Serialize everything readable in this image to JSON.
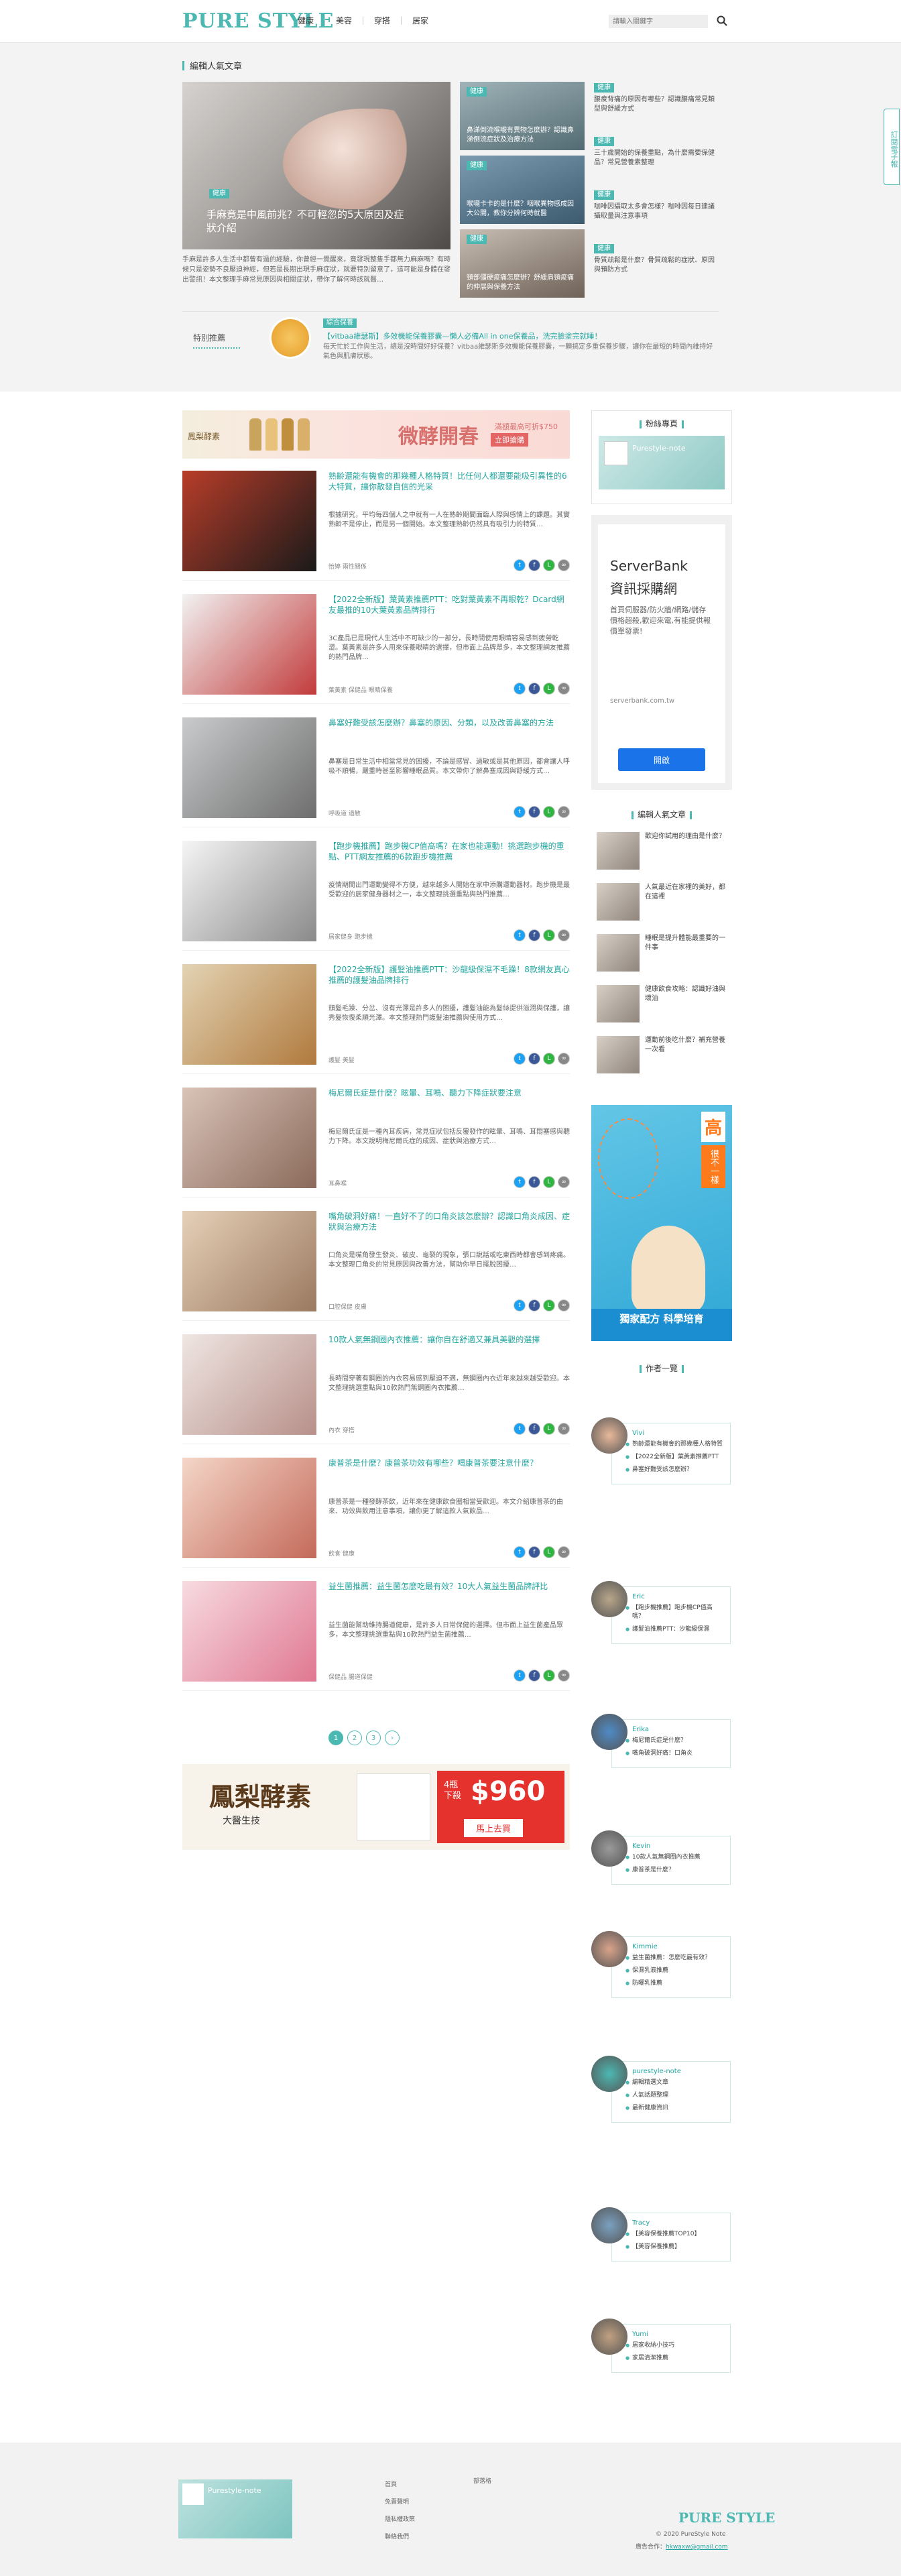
{
  "header": {
    "logo": "PURE STYLE",
    "nav": [
      "健康",
      "美容",
      "穿搭",
      "居家"
    ],
    "search_placeholder": "請輸入關鍵字"
  },
  "side_tab": "訂閱電子報",
  "featured": {
    "section_title": "編輯人氣文章",
    "big": {
      "tag": "健康",
      "title": "手麻竟是中風前兆？不可輕忽的5大原因及症狀介紹",
      "desc": "手麻是許多人生活中都曾有過的經驗，你曾經一覺醒來，竟發現整隻手都無力麻麻嗎？有時候只是姿勢不良壓迫神經，但若是長期出現手麻症狀，就要特別留意了，這可能是身體在發出警訊！本文整理手麻常見原因與相關症狀，帶你了解何時該就醫…"
    },
    "mid": [
      {
        "tag": "健康",
        "title": "鼻涕倒流喉嚨有異物怎麼辦？認識鼻涕倒流症狀及治療方法",
        "c1": "#9fb3b8",
        "c2": "#526b72"
      },
      {
        "tag": "健康",
        "title": "喉嚨卡卡的是什麼？咽喉異物感成因大公開，教你分辨何時就醫",
        "c1": "#7b9bb1",
        "c2": "#3d5a6e"
      },
      {
        "tag": "健康",
        "title": "頸部僵硬痠痛怎麼辦？舒緩肩頸痠痛的伸展與保養方法",
        "c1": "#c7bdb2",
        "c2": "#6f6258"
      }
    ],
    "right": [
      {
        "tag": "健康",
        "title": "腰痠背痛的原因有哪些？認識腰痛常見類型與舒緩方式"
      },
      {
        "tag": "健康",
        "title": "三十歲開始的保養重點，為什麼需要保健品？常見營養素整理"
      },
      {
        "tag": "健康",
        "title": "咖啡因攝取太多會怎樣？咖啡因每日建議攝取量與注意事項"
      },
      {
        "tag": "健康",
        "title": "骨質疏鬆是什麼？骨質疏鬆的症狀、原因與預防方式"
      }
    ],
    "hot": {
      "label": "特別推薦",
      "tag": "綜合保養",
      "title": "【vitbaa維瑟斯】多效機能保養膠囊—懶人必備All in one保養品，洗完臉塗完就睡！",
      "desc": "每天忙於工作與生活，總是沒時間好好保養？vitbaa維瑟斯多效機能保養膠囊，一顆搞定多重保養步驟，讓你在最短的時間內維持好氣色與肌膚狀態。"
    }
  },
  "banner1": {
    "left": "鳳梨酵素",
    "main": "微酵開春",
    "sub": "滿額最高可折$750",
    "cta": "立即搶購"
  },
  "posts": [
    {
      "title": "熟齡還能有機會的那幾種人格特質！比任何人都還要能吸引異性的6大特質，讓你散發自信的光采",
      "desc": "根據研究，平均每四個人之中就有一人在熟齡期間面臨人際與感情上的課題。其實熟齡不是停止，而是另一個開始。本文整理熟齡仍然具有吸引力的特質…",
      "meta": "怡婷  兩性關係",
      "thumb": "#b83d29",
      "thumb2": "#1a1a1a"
    },
    {
      "title": "【2022全新版】葉黃素推薦PTT：吃對葉黃素不再眼乾？Dcard網友最推的10大葉黃素品牌排行",
      "desc": "3C產品已是現代人生活中不可缺少的一部分，長時間使用眼睛容易感到疲勞乾澀。葉黃素是許多人用來保養眼睛的選擇，但市面上品牌眾多，本文整理網友推薦的熱門品牌…",
      "meta": "葉黃素  保健品  眼睛保養",
      "thumb": "#f2f2f2",
      "thumb2": "#c23b3b"
    },
    {
      "title": "鼻塞好難受該怎麼辦？鼻塞的原因、分類，以及改善鼻塞的方法",
      "desc": "鼻塞是日常生活中相當常見的困擾，不論是感冒、過敏或是其他原因，都會讓人呼吸不順暢，嚴重時甚至影響睡眠品質。本文帶你了解鼻塞成因與舒緩方式…",
      "meta": "呼吸道  過敏",
      "thumb": "#c9cbcc",
      "thumb2": "#6e6e6e"
    },
    {
      "title": "【跑步機推薦】跑步機CP值高嗎？在家也能運動！挑選跑步機的重點、PTT網友推薦的6款跑步機推薦",
      "desc": "疫情期間出門運動變得不方便，越來越多人開始在家中添購運動器材。跑步機是最受歡迎的居家健身器材之一，本文整理挑選重點與熱門推薦…",
      "meta": "居家健身  跑步機",
      "thumb": "#f5f5f5",
      "thumb2": "#8a8a8a"
    },
    {
      "title": "【2022全新版】護髮油推薦PTT：沙龍級保濕不毛躁！8款網友真心推薦的護髮油品牌排行",
      "desc": "頭髮毛躁、分岔、沒有光澤是許多人的困擾，護髮油能為髮絲提供滋潤與保護，讓秀髮恢復柔順光澤。本文整理熱門護髮油推薦與使用方式…",
      "meta": "護髮  美髮",
      "thumb": "#e3d3b3",
      "thumb2": "#b07a3e"
    },
    {
      "title": "梅尼爾氏症是什麼？眩暈、耳鳴、聽力下降症狀要注意",
      "desc": "梅尼爾氏症是一種內耳疾病，常見症狀包括反覆發作的眩暈、耳鳴、耳悶塞感與聽力下降。本文說明梅尼爾氏症的成因、症狀與治療方式…",
      "meta": "耳鼻喉",
      "thumb": "#d9c3b8",
      "thumb2": "#8a6a5a"
    },
    {
      "title": "嘴角破洞好痛！一直好不了的口角炎該怎麼辦？認識口角炎成因、症狀與治療方法",
      "desc": "口角炎是嘴角發生發炎、破皮、龜裂的現象，張口說話或吃東西時都會感到疼痛。本文整理口角炎的常見原因與改善方法，幫助你早日擺脫困擾…",
      "meta": "口腔保健  皮膚",
      "thumb": "#e6d0b8",
      "thumb2": "#9a7a60"
    },
    {
      "title": "10款人氣無鋼圈內衣推薦：讓你自在舒適又兼具美觀的選擇",
      "desc": "長時間穿著有鋼圈的內衣容易感到壓迫不適，無鋼圈內衣近年來越來越受歡迎。本文整理挑選重點與10款熱門無鋼圈內衣推薦…",
      "meta": "內衣  穿搭",
      "thumb": "#efe6e2",
      "thumb2": "#b8908a"
    },
    {
      "title": "康普茶是什麼？康普茶功效有哪些？喝康普茶要注意什麼？",
      "desc": "康普茶是一種發酵茶飲，近年來在健康飲食圈相當受歡迎。本文介紹康普茶的由來、功效與飲用注意事項，讓你更了解這款人氣飲品…",
      "meta": "飲食  健康",
      "thumb": "#f4d6c8",
      "thumb2": "#c46a5a"
    },
    {
      "title": "益生菌推薦：益生菌怎麼吃最有效？10大人氣益生菌品牌評比",
      "desc": "益生菌能幫助維持腸道健康，是許多人日常保健的選擇。但市面上益生菌產品眾多，本文整理挑選重點與10款熱門益生菌推薦…",
      "meta": "保健品  腸道保健",
      "thumb": "#f7dbe1",
      "thumb2": "#e07891"
    }
  ],
  "pager": [
    "1",
    "2",
    "3",
    "›"
  ],
  "banner2": {
    "title": "鳳梨酵素",
    "brand": "大醫生技",
    "offer": "4瓶下殺",
    "price": "$960",
    "cta": "馬上去買"
  },
  "sidebar": {
    "fb_title": "粉絲專頁",
    "fb_page": "Purestyle-note",
    "ad": {
      "brand": "ServerBank",
      "heading": "資訊採購網",
      "body": "首頁伺服器/防火牆/網路/儲存 價格超殺,歡迎來電,有能提供報價單發票!",
      "url": "serverbank.com.tw",
      "button": "開啟"
    },
    "pop_title": "編輯人氣文章",
    "pop": [
      "歡迎你試用的理由是什麼？",
      "人氣最近在家裡的美好，都在這裡",
      "睡眠是提升體能最重要的一件事",
      "健康飲食攻略：認識好油與壞油",
      "運動前後吃什麼？補充營養一次看"
    ],
    "ad2": {
      "a": "高",
      "b": "很不一樣",
      "c": "獨家配方 科學培育"
    },
    "authors_title": "作者一覽",
    "authors": [
      {
        "name": "Vivi",
        "items": [
          "熟齡還能有機會的那幾種人格特質",
          "【2022全新版】葉黃素推薦PTT",
          "鼻塞好難受該怎麼辦？"
        ],
        "c": "#e8b89a"
      },
      {
        "name": "Eric",
        "items": [
          "【跑步機推薦】跑步機CP值高嗎？",
          "護髮油推薦PTT：沙龍級保濕"
        ],
        "c": "#b8a68a"
      },
      {
        "name": "Erika",
        "items": [
          "梅尼爾氏症是什麼？",
          "嘴角破洞好痛！口角炎"
        ],
        "c": "#4e8ac6"
      },
      {
        "name": "Kevin",
        "items": [
          "10款人氣無鋼圈內衣推薦",
          "康普茶是什麼？"
        ],
        "c": "#9a9a9a"
      },
      {
        "name": "Kimmie",
        "items": [
          "益生菌推薦：怎麼吃最有效？",
          "保濕乳液推薦",
          "防曬乳推薦"
        ],
        "c": "#d9a38a"
      },
      {
        "name": "purestyle-note",
        "items": [
          "編輯精選文章",
          "人氣話題整理",
          "最新健康資訊"
        ],
        "c": "#4cb8b2"
      },
      {
        "name": "Tracy",
        "items": [
          "【美容保養推薦TOP10】",
          "【美容保養推薦】"
        ],
        "c": "#7aa0c0"
      },
      {
        "name": "Yumi",
        "items": [
          "居家收納小技巧",
          "家居清潔推薦"
        ],
        "c": "#c0a080"
      }
    ]
  },
  "footer": {
    "fb_page": "Purestyle-note",
    "links1": [
      "首頁",
      "免責聲明",
      "隱私權政策",
      "聯絡我們"
    ],
    "links2": [
      "部落格"
    ],
    "logo": "PURE STYLE",
    "copyright": "© 2020 PureStyle Note",
    "contact_label": "廣告合作：",
    "contact": "hkwaxw@gmail.com"
  }
}
